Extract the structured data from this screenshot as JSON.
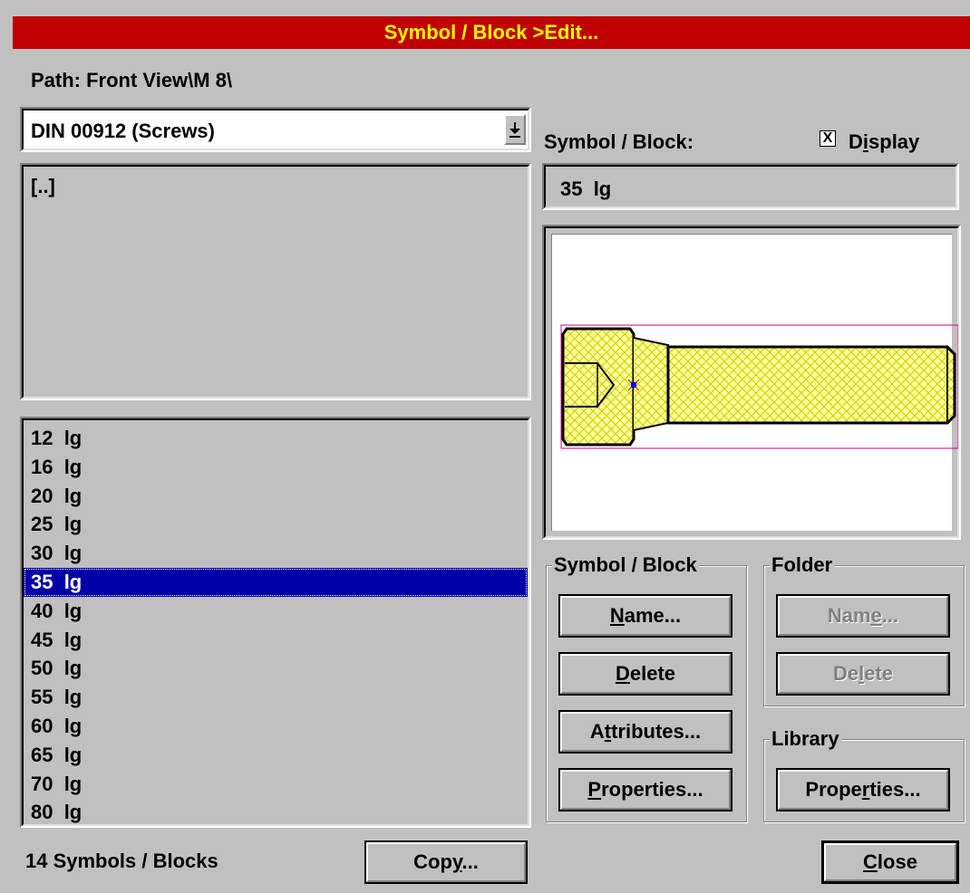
{
  "title": "Symbol / Block >Edit...",
  "path_label": "Path: Front View\\M  8\\",
  "library_select": {
    "value": "DIN 00912 (Screws)"
  },
  "folder_list": [
    "[..]"
  ],
  "symbol_list": {
    "items": [
      "12  lg",
      "16  lg",
      "20  lg",
      "25  lg",
      "30  lg",
      "35  lg",
      "40  lg",
      "45  lg",
      "50  lg",
      "55  lg",
      "60  lg",
      "65  lg",
      "70  lg",
      "80  lg"
    ],
    "selected_index": 5
  },
  "count_label": "14 Symbols / Blocks",
  "copy_button": {
    "pre": "Cop",
    "u": "y",
    "post": "..."
  },
  "symbol_block_label": "Symbol / Block:",
  "display_checkbox": {
    "checked": true,
    "mark": "X",
    "pre": "D",
    "u": "i",
    "post": "splay"
  },
  "current_symbol": "35  lg",
  "groups": {
    "symbol_block": {
      "label": "Symbol / Block",
      "name_button": {
        "pre": "",
        "u": "N",
        "post": "ame..."
      },
      "delete_button": {
        "pre": "",
        "u": "D",
        "post": "elete"
      },
      "attributes_button": {
        "pre": "A",
        "u": "t",
        "post": "tributes..."
      },
      "properties_button": {
        "pre": "",
        "u": "P",
        "post": "roperties..."
      }
    },
    "folder": {
      "label": "Folder",
      "name_button": {
        "pre": "Nam",
        "u": "e",
        "post": "..."
      },
      "delete_button": {
        "pre": "De",
        "u": "l",
        "post": "ete"
      }
    },
    "library": {
      "label": "Library",
      "properties_button": {
        "pre": "Prope",
        "u": "r",
        "post": "ties..."
      }
    }
  },
  "close_button": {
    "pre": "",
    "u": "C",
    "post": "lose"
  },
  "colors": {
    "title_bg": "#c00000",
    "title_fg": "#ffff00",
    "selection": "#0000a8",
    "face": "#c0c0c0",
    "hatch": "#ffff99"
  }
}
